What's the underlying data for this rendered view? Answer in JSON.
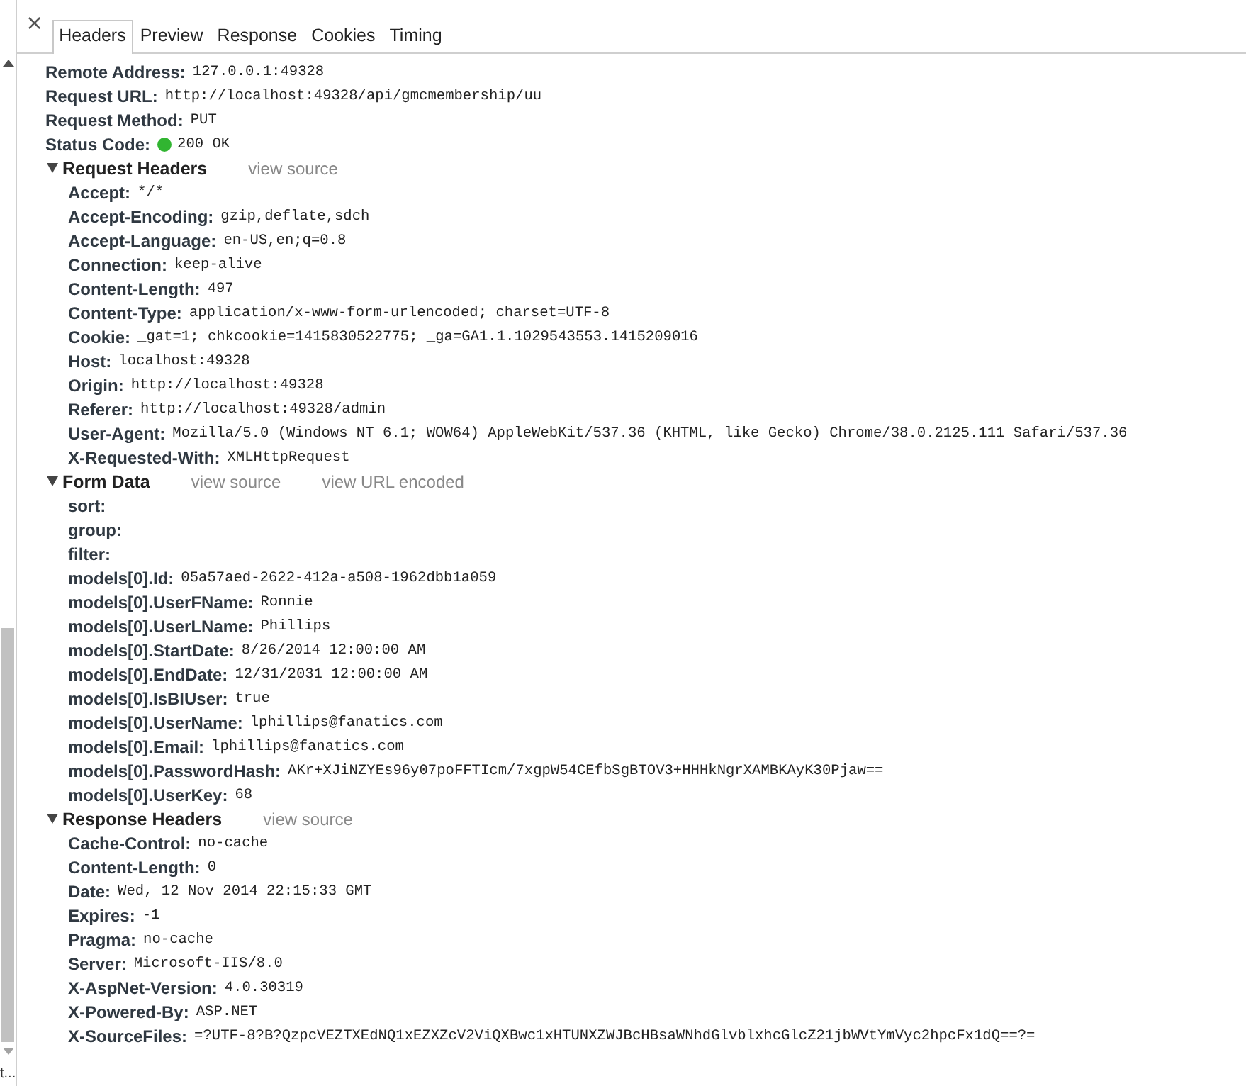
{
  "close_button": "×",
  "tabs": [
    {
      "label": "Headers",
      "selected": true
    },
    {
      "label": "Preview",
      "selected": false
    },
    {
      "label": "Response",
      "selected": false
    },
    {
      "label": "Cookies",
      "selected": false
    },
    {
      "label": "Timing",
      "selected": false
    }
  ],
  "general": [
    {
      "name": "Remote Address:",
      "value": "127.0.0.1:49328",
      "kind": "plain"
    },
    {
      "name": "Request URL:",
      "value": "http://localhost:49328/api/gmcmembership/uu",
      "kind": "plain"
    },
    {
      "name": "Request Method:",
      "value": "PUT",
      "kind": "plain"
    },
    {
      "name": "Status Code:",
      "value": "200 OK",
      "kind": "status",
      "color": "#31b531"
    }
  ],
  "sections": [
    {
      "title": "Request Headers",
      "expanded": true,
      "links": [
        "view source"
      ],
      "rows": [
        {
          "name": "Accept:",
          "value": "*/*"
        },
        {
          "name": "Accept-Encoding:",
          "value": "gzip,deflate,sdch"
        },
        {
          "name": "Accept-Language:",
          "value": "en-US,en;q=0.8"
        },
        {
          "name": "Connection:",
          "value": "keep-alive"
        },
        {
          "name": "Content-Length:",
          "value": "497"
        },
        {
          "name": "Content-Type:",
          "value": "application/x-www-form-urlencoded; charset=UTF-8"
        },
        {
          "name": "Cookie:",
          "value": "_gat=1; chkcookie=1415830522775; _ga=GA1.1.1029543553.1415209016"
        },
        {
          "name": "Host:",
          "value": "localhost:49328"
        },
        {
          "name": "Origin:",
          "value": "http://localhost:49328"
        },
        {
          "name": "Referer:",
          "value": "http://localhost:49328/admin"
        },
        {
          "name": "User-Agent:",
          "value": "Mozilla/5.0 (Windows NT 6.1; WOW64) AppleWebKit/537.36 (KHTML, like Gecko) Chrome/38.0.2125.111 Safari/537.36"
        },
        {
          "name": "X-Requested-With:",
          "value": "XMLHttpRequest"
        }
      ]
    },
    {
      "title": "Form Data",
      "expanded": true,
      "links": [
        "view source",
        "view URL encoded"
      ],
      "rows": [
        {
          "name": "sort:"
        },
        {
          "name": "group:"
        },
        {
          "name": "filter:"
        },
        {
          "name": "models[0].Id:",
          "value": "05a57aed-2622-412a-a508-1962dbb1a059"
        },
        {
          "name": "models[0].UserFName:",
          "value": "Ronnie"
        },
        {
          "name": "models[0].UserLName:",
          "value": "Phillips"
        },
        {
          "name": "models[0].StartDate:",
          "value": "8/26/2014 12:00:00 AM"
        },
        {
          "name": "models[0].EndDate:",
          "value": "12/31/2031 12:00:00 AM"
        },
        {
          "name": "models[0].IsBIUser:",
          "value": "true"
        },
        {
          "name": "models[0].UserName:",
          "value": "lphillips@fanatics.com"
        },
        {
          "name": "models[0].Email:",
          "value": "lphillips@fanatics.com"
        },
        {
          "name": "models[0].PasswordHash:",
          "value": "AKr+XJiNZYEs96y07poFFTIcm/7xgpW54CEfbSgBTOV3+HHHkNgrXAMBKAyK30Pjaw=="
        },
        {
          "name": "models[0].UserKey:",
          "value": "68"
        }
      ]
    },
    {
      "title": "Response Headers",
      "expanded": true,
      "links": [
        "view source"
      ],
      "rows": [
        {
          "name": "Cache-Control:",
          "value": "no-cache"
        },
        {
          "name": "Content-Length:",
          "value": "0"
        },
        {
          "name": "Date:",
          "value": "Wed, 12 Nov 2014 22:15:33 GMT"
        },
        {
          "name": "Expires:",
          "value": "-1"
        },
        {
          "name": "Pragma:",
          "value": "no-cache"
        },
        {
          "name": "Server:",
          "value": "Microsoft-IIS/8.0"
        },
        {
          "name": "X-AspNet-Version:",
          "value": "4.0.30319"
        },
        {
          "name": "X-Powered-By:",
          "value": "ASP.NET"
        },
        {
          "name": "X-SourceFiles:",
          "value": "=?UTF-8?B?QzpcVEZTXEdNQ1xEZXZcV2ViQXBwc1xHTUNXZWJBcHBsaWNhdGlvblxhcGlcZ21jbWVtYmVyc2hpcFx1dQ==?="
        }
      ]
    }
  ],
  "corner_text": "t..."
}
